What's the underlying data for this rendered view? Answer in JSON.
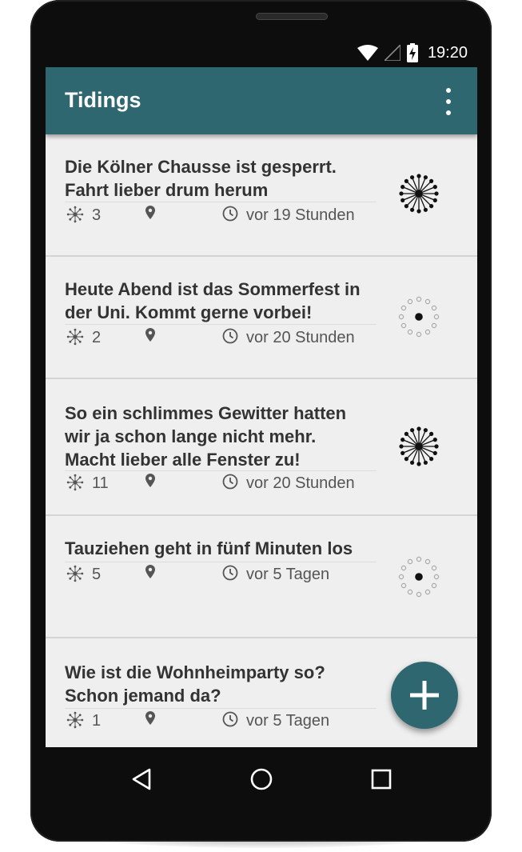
{
  "status_bar": {
    "time": "19:20"
  },
  "app_bar": {
    "title": "Tidings",
    "menu_icon": "more-vert-icon"
  },
  "posts": [
    {
      "text_lines": [
        "Die Kölner Chausse ist gesperrt.",
        "Fahrt lieber drum herum"
      ],
      "count": "3",
      "time": "vor 19 Stunden",
      "indicator": "active"
    },
    {
      "text_lines": [
        "Heute Abend ist das Sommerfest in",
        "der Uni. Kommt gerne vorbei!"
      ],
      "count": "2",
      "time": "vor 20 Stunden",
      "indicator": "inactive"
    },
    {
      "text_lines": [
        "So ein schlimmes Gewitter hatten",
        "wir ja schon lange nicht mehr.",
        "Macht lieber alle Fenster zu!"
      ],
      "count": "11",
      "time": "vor 20 Stunden",
      "indicator": "active"
    },
    {
      "text_lines": [
        "Tauziehen geht in fünf Minuten los"
      ],
      "count": "5",
      "time": "vor 5 Tagen",
      "indicator": "inactive"
    },
    {
      "text_lines": [
        "Wie ist die Wohnheimparty so?",
        "Schon jemand da?"
      ],
      "count": "1",
      "time": "vor 5 Tagen",
      "indicator": "none"
    }
  ],
  "fab": {
    "icon": "plus-icon"
  },
  "nav_bar": {
    "back_icon": "back-triangle-icon",
    "home_icon": "home-circle-icon",
    "recents_icon": "recents-square-icon"
  },
  "colors": {
    "primary": "#2e6770",
    "background": "#efefef",
    "text": "#333333"
  }
}
